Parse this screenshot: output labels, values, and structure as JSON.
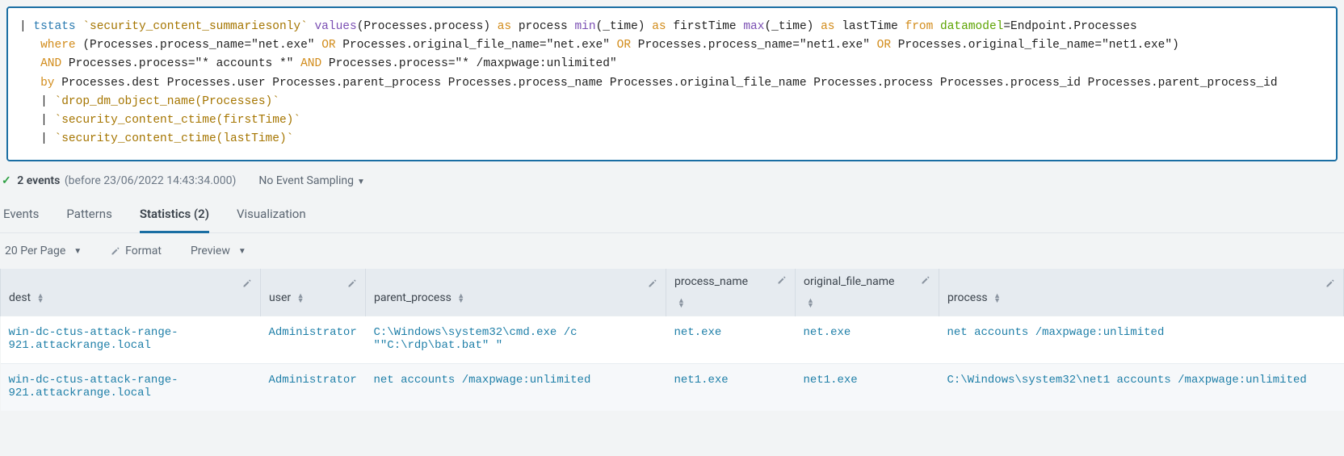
{
  "search": {
    "tokens": {
      "pipe": "|",
      "tstats": "tstats",
      "macro_sum": "`security_content_summariesonly`",
      "values": "values",
      "proc_arg": "(Processes.process)",
      "as": "as",
      "process": "process",
      "min": "min",
      "time_arg": "(_time)",
      "firstTime": "firstTime",
      "max": "max",
      "lastTime": "lastTime",
      "from": "from",
      "datamodel": "datamodel",
      "dm_val": "=Endpoint.Processes",
      "where": "where",
      "cond1a": "(Processes.process_name=\"net.exe\"",
      "OR": "OR",
      "cond1b": "Processes.original_file_name=\"net.exe\"",
      "cond1c": "Processes.process_name=\"net1.exe\"",
      "cond1d": "Processes.original_file_name=\"net1.exe\")",
      "AND": "AND",
      "cond2": "Processes.process=\"* accounts *\"",
      "cond3": "Processes.process=\"* /maxpwage:unlimited\"",
      "by": "by",
      "byfields": "Processes.dest Processes.user Processes.parent_process Processes.process_name Processes.original_file_name Processes.process Processes.process_id Processes.parent_process_id",
      "macro_drop": "`drop_dm_object_name(Processes)`",
      "macro_ctime_first": "`security_content_ctime(firstTime)`",
      "macro_ctime_last": "`security_content_ctime(lastTime)`"
    }
  },
  "infobar": {
    "check": "✓",
    "events_count": "2 events",
    "events_paren": "(before 23/06/2022 14:43:34.000)",
    "sampling": "No Event Sampling"
  },
  "tabs": {
    "events": "Events",
    "patterns": "Patterns",
    "statistics": "Statistics (2)",
    "visualization": "Visualization"
  },
  "toolbar": {
    "per_page": "20 Per Page",
    "format": "Format",
    "preview": "Preview"
  },
  "columns": {
    "dest": "dest",
    "user": "user",
    "parent_process": "parent_process",
    "process_name": "process_name",
    "original_file_name": "original_file_name",
    "process": "process"
  },
  "rows": [
    {
      "dest": "win-dc-ctus-attack-range-921.attackrange.local",
      "user": "Administrator",
      "parent_process": "C:\\Windows\\system32\\cmd.exe /c \"\"C:\\rdp\\bat.bat\" \"",
      "process_name": "net.exe",
      "original_file_name": "net.exe",
      "process": "net  accounts /maxpwage:unlimited"
    },
    {
      "dest": "win-dc-ctus-attack-range-921.attackrange.local",
      "user": "Administrator",
      "parent_process": "net  accounts /maxpwage:unlimited",
      "process_name": "net1.exe",
      "original_file_name": "net1.exe",
      "process": "C:\\Windows\\system32\\net1  accounts /maxpwage:unlimited"
    }
  ]
}
